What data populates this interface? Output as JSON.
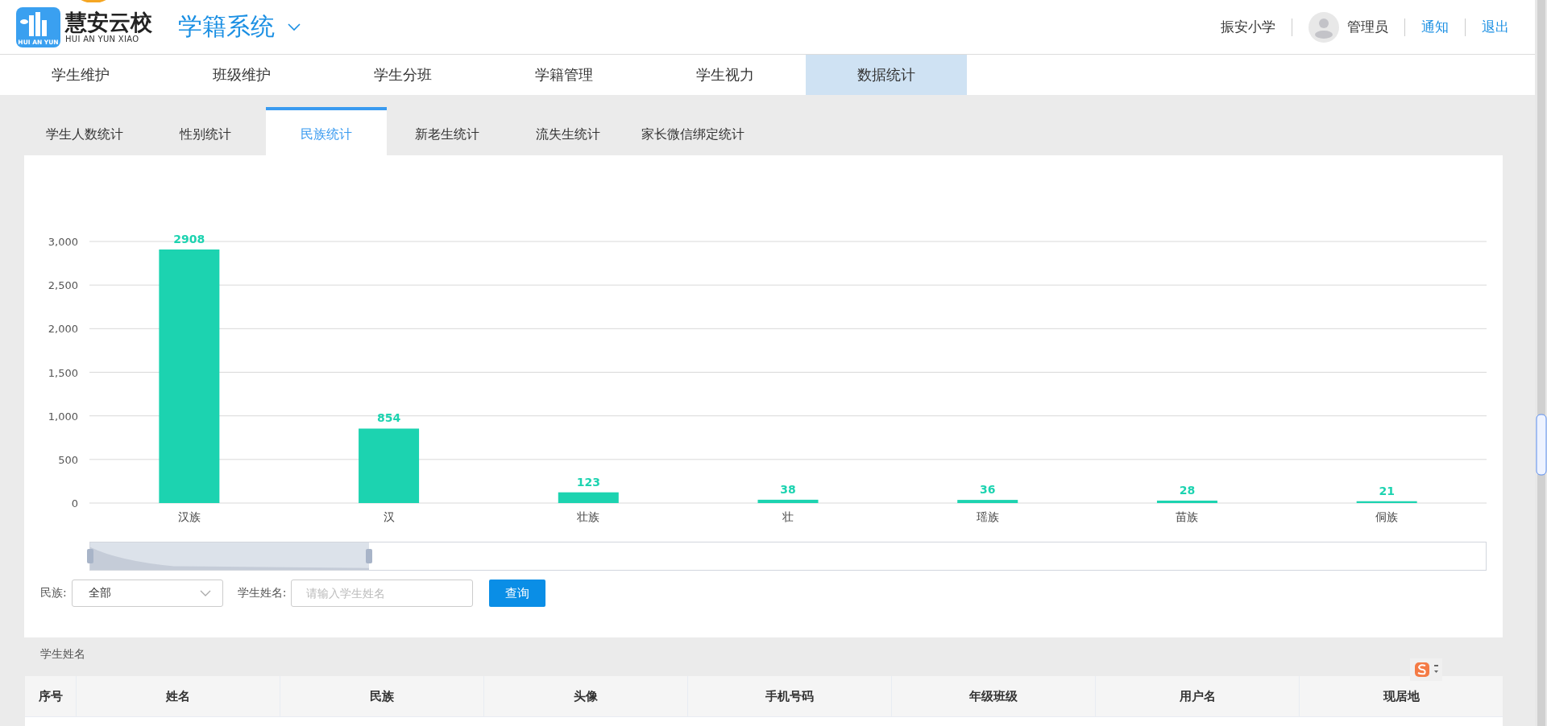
{
  "header": {
    "logo_title": "慧安云校",
    "logo_subtitle": "HUI AN YUN XIAO",
    "logo_badge": "HUI AN YUN",
    "system_title": "学籍系统",
    "school": "振安小学",
    "user": "管理员",
    "links": [
      "通知",
      "退出"
    ]
  },
  "nav": [
    {
      "label": "学生维护",
      "selected": false
    },
    {
      "label": "班级维护",
      "selected": false
    },
    {
      "label": "学生分班",
      "selected": false
    },
    {
      "label": "学籍管理",
      "selected": false
    },
    {
      "label": "学生视力",
      "selected": false
    },
    {
      "label": "数据统计",
      "selected": true
    }
  ],
  "subtabs": [
    {
      "label": "学生人数统计",
      "selected": false
    },
    {
      "label": "性别统计",
      "selected": false
    },
    {
      "label": "民族统计",
      "selected": true
    },
    {
      "label": "新老生统计",
      "selected": false
    },
    {
      "label": "流失生统计",
      "selected": false
    },
    {
      "label": "家长微信绑定统计",
      "selected": false
    }
  ],
  "chart": {
    "chart_data": {
      "type": "bar",
      "categories": [
        "汉族",
        "汉",
        "壮族",
        "壮",
        "瑶族",
        "苗族",
        "侗族"
      ],
      "series": [
        {
          "color": "#1cd3b0",
          "values": [
            2908,
            854,
            123,
            38,
            36,
            28,
            21
          ]
        }
      ],
      "ylim": [
        0,
        3000
      ],
      "yticks": [
        {
          "value": 0,
          "label": "0"
        },
        {
          "value": 500,
          "label": "500"
        },
        {
          "value": 1000,
          "label": "1,000"
        },
        {
          "value": 1500,
          "label": "1,500"
        },
        {
          "value": 2000,
          "label": "2,000"
        },
        {
          "value": 2500,
          "label": "2,500"
        },
        {
          "value": 3000,
          "label": "3,000"
        }
      ],
      "data_labels": true,
      "grid": true
    },
    "data_zoom": {
      "level": 0.2
    }
  },
  "filters": {
    "ethnicity_label": "民族:",
    "ethnicity_value": "全部",
    "name_label": "学生姓名:",
    "name_placeholder": "请输入学生姓名",
    "query_button": "查询"
  },
  "table": {
    "caption": "学生姓名",
    "columns": [
      "序号",
      "姓名",
      "民族",
      "头像",
      "手机号码",
      "年级班级",
      "用户名",
      "现居地"
    ]
  }
}
